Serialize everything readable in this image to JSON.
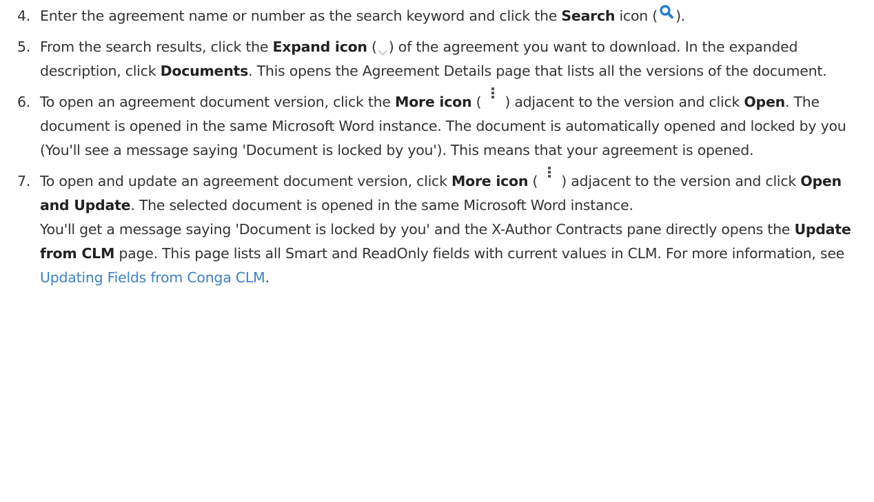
{
  "steps": [
    {
      "num": "4.",
      "a": "Enter the agreement name or number as the search keyword and click the ",
      "b1": "Search",
      "c": " icon (",
      "d": ")."
    },
    {
      "num": "5.",
      "a": "From the search results, click the ",
      "b1": "Expand icon",
      "c": " (",
      "d": ") of the agreement you want to download. In the expanded description, click ",
      "b2": "Documents",
      "e": ". This opens the Agreement Details page that lists all the versions of the document."
    },
    {
      "num": "6.",
      "a": "To open an agreement document version, click the ",
      "b1": "More icon",
      "c": " (",
      "d": ") adjacent to the version and click ",
      "b2": "Open",
      "e": ". The document is opened in the same Microsoft Word instance. The document is automatically opened and locked by you (You'll see a message saying 'Document is locked by you'). This means that your agreement is opened."
    },
    {
      "num": "7.",
      "a": "To open and update an agreement document version, click ",
      "b1": "More icon",
      "c": " (",
      "d": ") adjacent to the version and click ",
      "b2": "Open and Update",
      "e": ". The selected document is opened in the same Microsoft Word instance.",
      "p2a": "You'll get a message saying 'Document is locked by you' and the X-Author Contracts pane directly opens the ",
      "p2b": "Update from CLM",
      "p2c": " page. This page lists all Smart and ReadOnly fields with current values in CLM. For more information, see ",
      "link": "Updating Fields from Conga CLM",
      "p2d": "."
    }
  ],
  "icons": {
    "search": "search-icon",
    "expand": "chevron-down-icon",
    "more": "more-vertical-icon"
  },
  "colors": {
    "text": "#333333",
    "link": "#3d82c4",
    "search_icon": "#2b7bd3",
    "expand_icon": "#c9d1da",
    "more_icon": "#555555"
  }
}
